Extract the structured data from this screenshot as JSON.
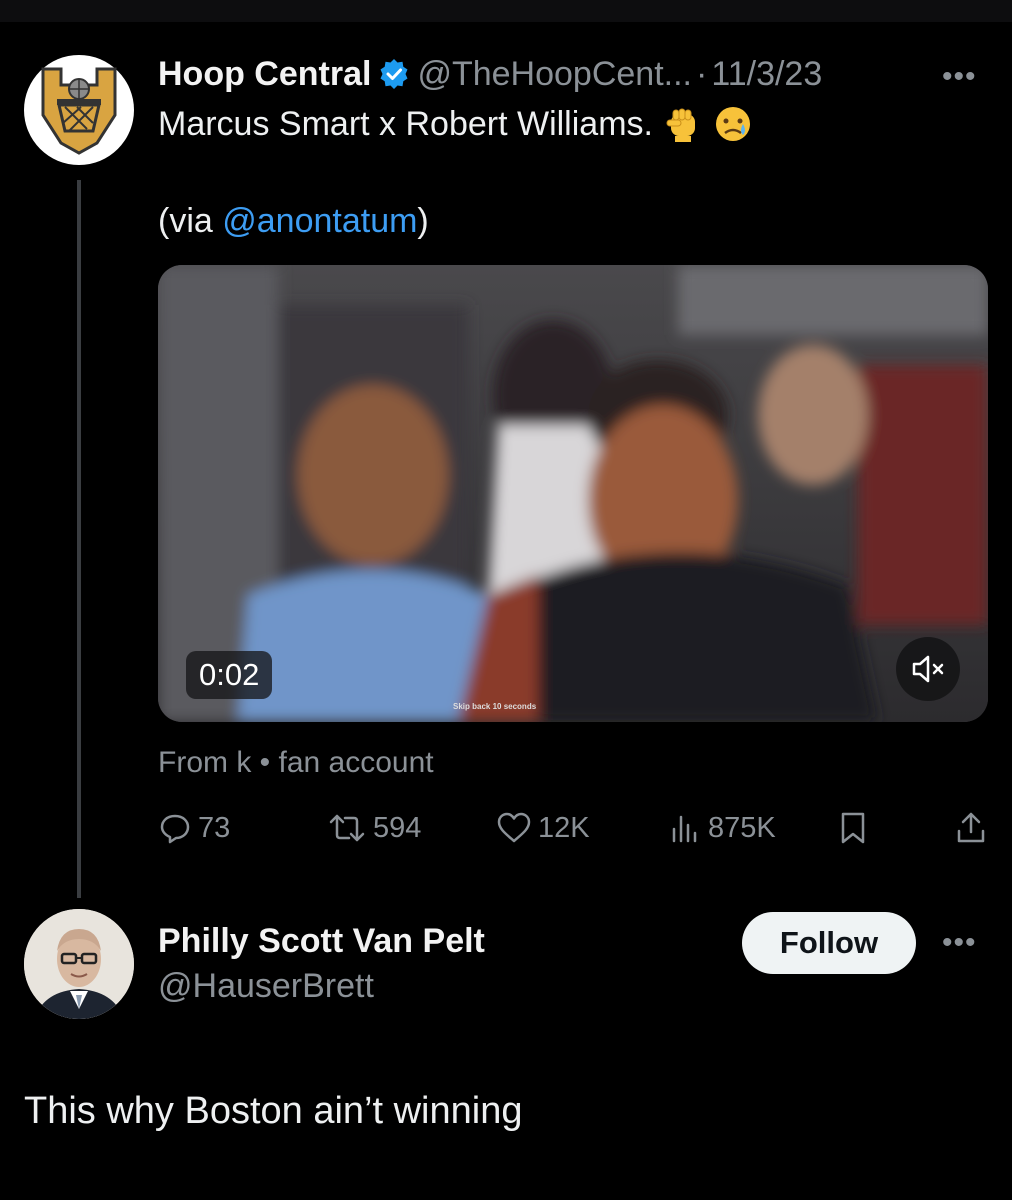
{
  "tweet": {
    "author_name": "Hoop Central",
    "handle": "@TheHoopCent...",
    "separator": "·",
    "date": "11/3/23",
    "more_label": "•••",
    "text_line1": "Marcus Smart x Robert Williams.",
    "via_prefix": "(via ",
    "via_mention": "@anontatum",
    "via_suffix": ")",
    "video": {
      "time": "0:02",
      "skip_caption": "Skip back 10 seconds"
    },
    "from_label": "From k • fan account",
    "stats": {
      "replies": "73",
      "retweets": "594",
      "likes": "12K",
      "views": "875K"
    }
  },
  "reply": {
    "author_name": "Philly Scott Van Pelt",
    "handle": "@HauserBrett",
    "follow_label": "Follow",
    "more_label": "•••",
    "text": "This why Boston ain’t winning"
  },
  "colors": {
    "background": "#000000",
    "text": "#e7e9ea",
    "secondary": "#8b9197",
    "link": "#3d9df3",
    "verified": "#1d9bf0",
    "thread_line": "#3a3d41"
  },
  "icons": [
    "verified-badge-icon",
    "flexed-fist-emoji",
    "crying-face-emoji",
    "mute-icon",
    "reply-icon",
    "retweet-icon",
    "like-icon",
    "views-icon",
    "bookmark-icon",
    "share-icon",
    "more-icon"
  ]
}
